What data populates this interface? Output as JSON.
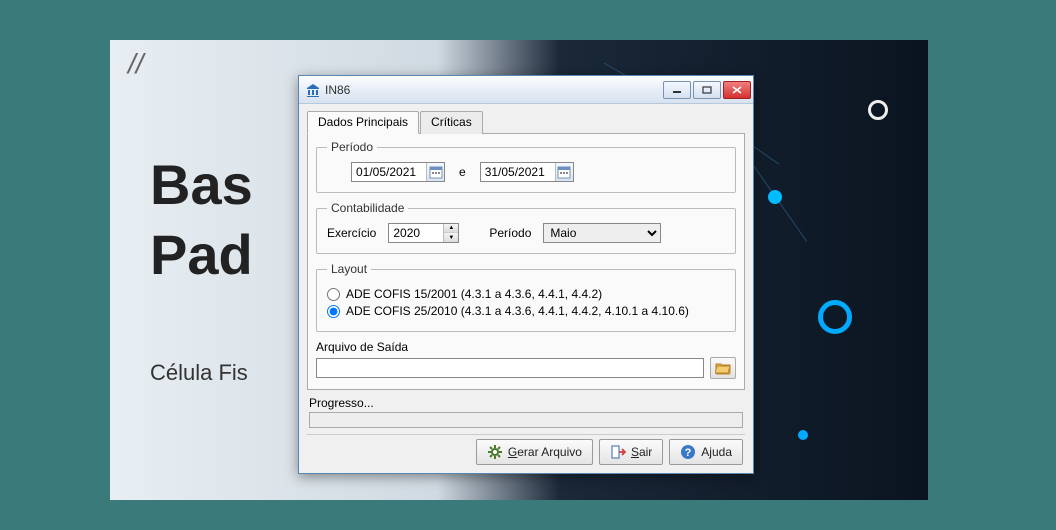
{
  "bg": {
    "heading_line1": "Bas",
    "heading_line2": "Pad",
    "subtext": "Célula Fis",
    "slash": "//"
  },
  "window": {
    "title": "IN86"
  },
  "tabs": {
    "main": "Dados Principais",
    "critics": "Críticas"
  },
  "periodo": {
    "legend": "Período",
    "start": "01/05/2021",
    "sep": "e",
    "end": "31/05/2021"
  },
  "contabilidade": {
    "legend": "Contabilidade",
    "exercicio_label": "Exercício",
    "exercicio_value": "2020",
    "periodo_label": "Período",
    "periodo_value": "Maio"
  },
  "layout": {
    "legend": "Layout",
    "opt1": "ADE COFIS 15/2001 (4.3.1 a 4.3.6, 4.4.1, 4.4.2)",
    "opt2": "ADE COFIS 25/2010 (4.3.1 a 4.3.6, 4.4.1, 4.4.2, 4.10.1 a 4.10.6)"
  },
  "output": {
    "label": "Arquivo de Saída",
    "value": ""
  },
  "progress": {
    "label": "Progresso..."
  },
  "buttons": {
    "gerar_prefix": "G",
    "gerar_rest": "erar Arquivo",
    "sair_prefix": "S",
    "sair_rest": "air",
    "ajuda": "Ajuda"
  }
}
